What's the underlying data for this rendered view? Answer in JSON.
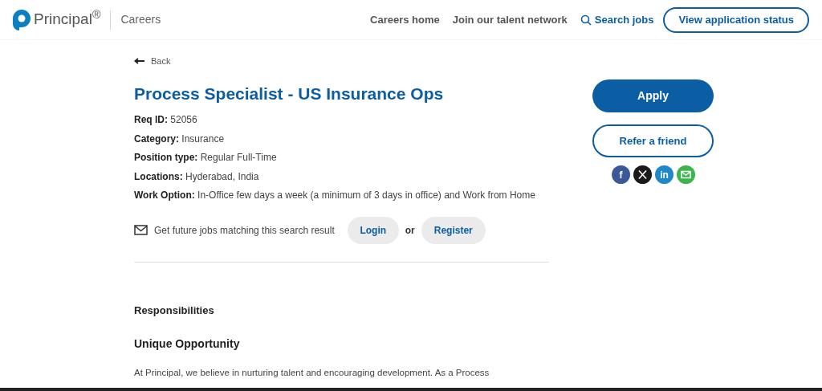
{
  "header": {
    "logo_text": "Principal",
    "logo_mark": "®",
    "section": "Careers",
    "nav": [
      "Careers home",
      "Join our talent network"
    ],
    "search_link": "Search jobs",
    "status_button": "View application status"
  },
  "back_link": "Back",
  "job": {
    "title": "Process Specialist - US Insurance Ops",
    "fields": [
      {
        "label": "Req ID:",
        "value": "52056"
      },
      {
        "label": "Category:",
        "value": "Insurance"
      },
      {
        "label": "Position type:",
        "value": "Regular Full-Time"
      },
      {
        "label": "Locations:",
        "value": "Hyderabad, India"
      },
      {
        "label": "Work Option:",
        "value": "In-Office few days a week (a minimum of 3 days in office) and Work from Home"
      }
    ]
  },
  "alerts": {
    "text": "Get future jobs matching this search result",
    "login": "Login",
    "or": "or",
    "register": "Register"
  },
  "apply_button": "Apply",
  "refer_button": "Refer a friend",
  "share": [
    {
      "kind": "facebook",
      "color": "#3b5998",
      "glyph": "f"
    },
    {
      "kind": "x",
      "color": "#1a1a1a"
    },
    {
      "kind": "linkedin",
      "color": "#1e88c9",
      "glyph": "in"
    },
    {
      "kind": "email",
      "color": "#3cb54a"
    }
  ],
  "description": {
    "section": "Responsibilities",
    "subheading": "Unique Opportunity",
    "paragraph": "At Principal, we believe in nurturing talent and encouraging development. As a Process"
  }
}
